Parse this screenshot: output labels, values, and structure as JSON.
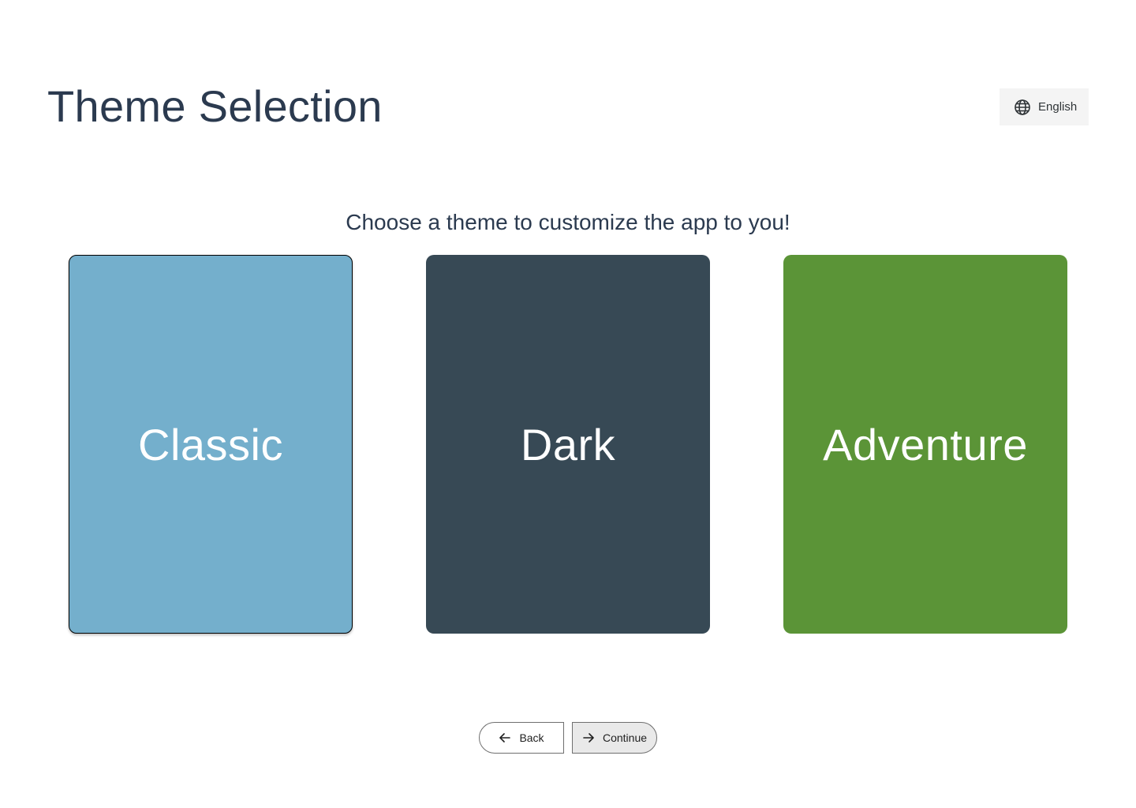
{
  "header": {
    "title": "Theme Selection",
    "language_label": "English",
    "language_icon": "globe-icon"
  },
  "main": {
    "subtitle": "Choose a theme to customize the app to you!",
    "themes": [
      {
        "label": "Classic",
        "color": "#74afcc",
        "selected": true
      },
      {
        "label": "Dark",
        "color": "#374955",
        "selected": false
      },
      {
        "label": "Adventure",
        "color": "#5b9437",
        "selected": false
      }
    ]
  },
  "footer": {
    "back_label": "Back",
    "back_icon": "arrow-left-icon",
    "continue_label": "Continue",
    "continue_icon": "arrow-right-icon"
  },
  "colors": {
    "heading": "#2b3a4f",
    "language_button_bg": "#f4f4f4",
    "continue_button_bg": "#e9e9e9"
  }
}
